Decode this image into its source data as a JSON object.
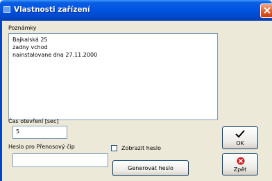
{
  "window": {
    "title": "Vlastnosti zařízení"
  },
  "notes": {
    "label": "Poznámky",
    "lines": [
      "Bajkalská 25",
      "zadny vchod",
      "nainstalovane dna 27.11.2000"
    ]
  },
  "open_time": {
    "label": "Čas otevření [sec]",
    "value": "5"
  },
  "password": {
    "label": "Heslo pro Přenosový čip",
    "value": ""
  },
  "show_password": {
    "label": "Zobrazit heslo",
    "checked": false
  },
  "buttons": {
    "generate": "Generovat heslo",
    "ok": "OK",
    "back": "Zpět"
  }
}
